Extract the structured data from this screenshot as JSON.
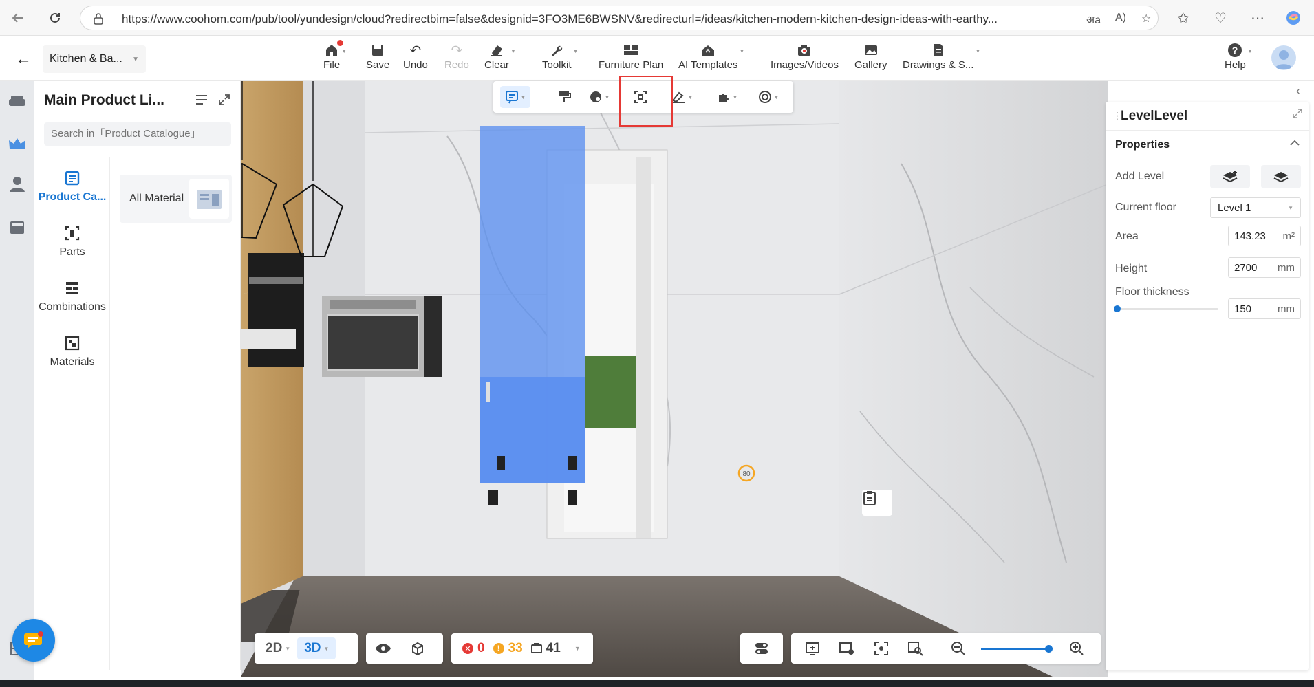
{
  "browser": {
    "url": "https://www.coohom.com/pub/tool/yundesign/cloud?redirectbim=false&designid=3FO3ME6BWSNV&redirecturl=/ideas/kitchen-modern-kitchen-design-ideas-with-earthy..."
  },
  "header": {
    "project_name": "Kitchen & Ba...",
    "tools": {
      "file": "File",
      "save": "Save",
      "undo": "Undo",
      "redo": "Redo",
      "clear": "Clear",
      "toolkit": "Toolkit",
      "furniture_plan": "Furniture Plan",
      "ai_templates": "AI Templates",
      "images_videos": "Images/Videos",
      "gallery": "Gallery",
      "drawings": "Drawings & S...",
      "help": "Help"
    }
  },
  "library": {
    "title": "Main Product Li...",
    "search_placeholder": "Search in「Product Catalogue」",
    "categories": [
      {
        "label": "Product Ca...",
        "active": true
      },
      {
        "label": "Parts",
        "active": false
      },
      {
        "label": "Combinations",
        "active": false
      },
      {
        "label": "Materials",
        "active": false
      }
    ],
    "all_material": "All Material"
  },
  "viewport": {
    "view_modes": {
      "two_d": "2D",
      "three_d": "3D",
      "active": "3D"
    },
    "stats": {
      "errors": "0",
      "warnings": "33",
      "items": "41"
    },
    "colors": {
      "accent": "#1976d2",
      "error": "#e53935",
      "warning": "#f5a623",
      "selection": "#5b8ff0"
    }
  },
  "properties": {
    "title": "LevelLevel",
    "section": "Properties",
    "add_level_label": "Add Level",
    "current_floor_label": "Current floor",
    "current_floor_value": "Level 1",
    "area_label": "Area",
    "area_value": "143.23",
    "area_unit": "m²",
    "height_label": "Height",
    "height_value": "2700",
    "height_unit": "mm",
    "floor_thickness_label": "Floor thickness",
    "floor_thickness_value": "150",
    "floor_thickness_unit": "mm"
  }
}
